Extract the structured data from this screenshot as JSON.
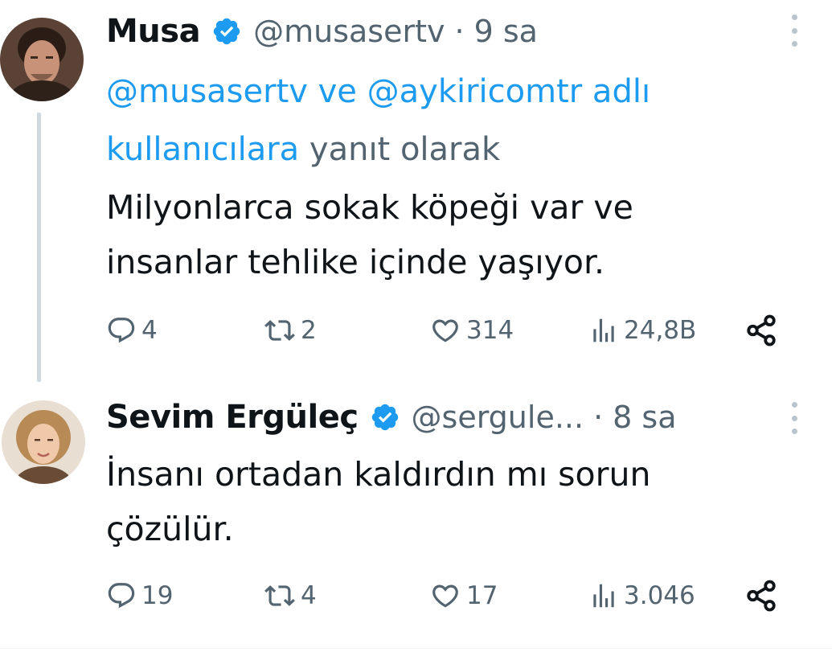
{
  "tweets": [
    {
      "name": "Musa",
      "handle": "@musasertv",
      "separator": "·",
      "time": "9 sa",
      "reply_to": {
        "link_1": "@musasertv",
        "connector": " ve ",
        "link_2": "@aykiricomtr",
        "link_3": " adlı kullanıcılara",
        "suffix": " yanıt olarak"
      },
      "text": "Milyonlarca sokak köpeği var ve insanlar tehlike içinde yaşıyor.",
      "stats": {
        "replies": "4",
        "retweets": "2",
        "likes": "314",
        "views": "24,8B"
      }
    },
    {
      "name": "Sevim Ergüleç",
      "handle": "@sergule...",
      "separator": "·",
      "time": "8 sa",
      "text": "İnsanı ortadan kaldırdın mı sorun çözülür.",
      "stats": {
        "replies": "19",
        "retweets": "4",
        "likes": "17",
        "views": "3.046"
      }
    }
  ],
  "colors": {
    "text": "#0f1419",
    "secondary": "#536471",
    "link": "#1d9bf0",
    "verified": "#1d9bf0",
    "thread_line": "#cfd9de"
  },
  "icons": [
    "verified-badge-icon",
    "more-icon",
    "reply-icon",
    "retweet-icon",
    "like-icon",
    "views-icon",
    "share-icon"
  ]
}
